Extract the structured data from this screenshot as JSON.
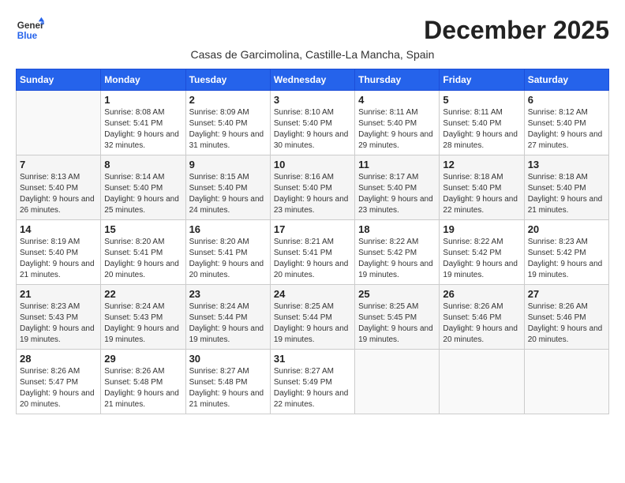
{
  "logo": {
    "general": "General",
    "blue": "Blue"
  },
  "title": "December 2025",
  "subtitle": "Casas de Garcimolina, Castille-La Mancha, Spain",
  "calendar": {
    "headers": [
      "Sunday",
      "Monday",
      "Tuesday",
      "Wednesday",
      "Thursday",
      "Friday",
      "Saturday"
    ],
    "weeks": [
      [
        {
          "day": "",
          "sunrise": "",
          "sunset": "",
          "daylight": "",
          "empty": true
        },
        {
          "day": "1",
          "sunrise": "Sunrise: 8:08 AM",
          "sunset": "Sunset: 5:41 PM",
          "daylight": "Daylight: 9 hours and 32 minutes."
        },
        {
          "day": "2",
          "sunrise": "Sunrise: 8:09 AM",
          "sunset": "Sunset: 5:40 PM",
          "daylight": "Daylight: 9 hours and 31 minutes."
        },
        {
          "day": "3",
          "sunrise": "Sunrise: 8:10 AM",
          "sunset": "Sunset: 5:40 PM",
          "daylight": "Daylight: 9 hours and 30 minutes."
        },
        {
          "day": "4",
          "sunrise": "Sunrise: 8:11 AM",
          "sunset": "Sunset: 5:40 PM",
          "daylight": "Daylight: 9 hours and 29 minutes."
        },
        {
          "day": "5",
          "sunrise": "Sunrise: 8:11 AM",
          "sunset": "Sunset: 5:40 PM",
          "daylight": "Daylight: 9 hours and 28 minutes."
        },
        {
          "day": "6",
          "sunrise": "Sunrise: 8:12 AM",
          "sunset": "Sunset: 5:40 PM",
          "daylight": "Daylight: 9 hours and 27 minutes."
        }
      ],
      [
        {
          "day": "7",
          "sunrise": "Sunrise: 8:13 AM",
          "sunset": "Sunset: 5:40 PM",
          "daylight": "Daylight: 9 hours and 26 minutes."
        },
        {
          "day": "8",
          "sunrise": "Sunrise: 8:14 AM",
          "sunset": "Sunset: 5:40 PM",
          "daylight": "Daylight: 9 hours and 25 minutes."
        },
        {
          "day": "9",
          "sunrise": "Sunrise: 8:15 AM",
          "sunset": "Sunset: 5:40 PM",
          "daylight": "Daylight: 9 hours and 24 minutes."
        },
        {
          "day": "10",
          "sunrise": "Sunrise: 8:16 AM",
          "sunset": "Sunset: 5:40 PM",
          "daylight": "Daylight: 9 hours and 23 minutes."
        },
        {
          "day": "11",
          "sunrise": "Sunrise: 8:17 AM",
          "sunset": "Sunset: 5:40 PM",
          "daylight": "Daylight: 9 hours and 23 minutes."
        },
        {
          "day": "12",
          "sunrise": "Sunrise: 8:18 AM",
          "sunset": "Sunset: 5:40 PM",
          "daylight": "Daylight: 9 hours and 22 minutes."
        },
        {
          "day": "13",
          "sunrise": "Sunrise: 8:18 AM",
          "sunset": "Sunset: 5:40 PM",
          "daylight": "Daylight: 9 hours and 21 minutes."
        }
      ],
      [
        {
          "day": "14",
          "sunrise": "Sunrise: 8:19 AM",
          "sunset": "Sunset: 5:40 PM",
          "daylight": "Daylight: 9 hours and 21 minutes."
        },
        {
          "day": "15",
          "sunrise": "Sunrise: 8:20 AM",
          "sunset": "Sunset: 5:41 PM",
          "daylight": "Daylight: 9 hours and 20 minutes."
        },
        {
          "day": "16",
          "sunrise": "Sunrise: 8:20 AM",
          "sunset": "Sunset: 5:41 PM",
          "daylight": "Daylight: 9 hours and 20 minutes."
        },
        {
          "day": "17",
          "sunrise": "Sunrise: 8:21 AM",
          "sunset": "Sunset: 5:41 PM",
          "daylight": "Daylight: 9 hours and 20 minutes."
        },
        {
          "day": "18",
          "sunrise": "Sunrise: 8:22 AM",
          "sunset": "Sunset: 5:42 PM",
          "daylight": "Daylight: 9 hours and 19 minutes."
        },
        {
          "day": "19",
          "sunrise": "Sunrise: 8:22 AM",
          "sunset": "Sunset: 5:42 PM",
          "daylight": "Daylight: 9 hours and 19 minutes."
        },
        {
          "day": "20",
          "sunrise": "Sunrise: 8:23 AM",
          "sunset": "Sunset: 5:42 PM",
          "daylight": "Daylight: 9 hours and 19 minutes."
        }
      ],
      [
        {
          "day": "21",
          "sunrise": "Sunrise: 8:23 AM",
          "sunset": "Sunset: 5:43 PM",
          "daylight": "Daylight: 9 hours and 19 minutes."
        },
        {
          "day": "22",
          "sunrise": "Sunrise: 8:24 AM",
          "sunset": "Sunset: 5:43 PM",
          "daylight": "Daylight: 9 hours and 19 minutes."
        },
        {
          "day": "23",
          "sunrise": "Sunrise: 8:24 AM",
          "sunset": "Sunset: 5:44 PM",
          "daylight": "Daylight: 9 hours and 19 minutes."
        },
        {
          "day": "24",
          "sunrise": "Sunrise: 8:25 AM",
          "sunset": "Sunset: 5:44 PM",
          "daylight": "Daylight: 9 hours and 19 minutes."
        },
        {
          "day": "25",
          "sunrise": "Sunrise: 8:25 AM",
          "sunset": "Sunset: 5:45 PM",
          "daylight": "Daylight: 9 hours and 19 minutes."
        },
        {
          "day": "26",
          "sunrise": "Sunrise: 8:26 AM",
          "sunset": "Sunset: 5:46 PM",
          "daylight": "Daylight: 9 hours and 20 minutes."
        },
        {
          "day": "27",
          "sunrise": "Sunrise: 8:26 AM",
          "sunset": "Sunset: 5:46 PM",
          "daylight": "Daylight: 9 hours and 20 minutes."
        }
      ],
      [
        {
          "day": "28",
          "sunrise": "Sunrise: 8:26 AM",
          "sunset": "Sunset: 5:47 PM",
          "daylight": "Daylight: 9 hours and 20 minutes."
        },
        {
          "day": "29",
          "sunrise": "Sunrise: 8:26 AM",
          "sunset": "Sunset: 5:48 PM",
          "daylight": "Daylight: 9 hours and 21 minutes."
        },
        {
          "day": "30",
          "sunrise": "Sunrise: 8:27 AM",
          "sunset": "Sunset: 5:48 PM",
          "daylight": "Daylight: 9 hours and 21 minutes."
        },
        {
          "day": "31",
          "sunrise": "Sunrise: 8:27 AM",
          "sunset": "Sunset: 5:49 PM",
          "daylight": "Daylight: 9 hours and 22 minutes."
        },
        {
          "day": "",
          "sunrise": "",
          "sunset": "",
          "daylight": "",
          "empty": true
        },
        {
          "day": "",
          "sunrise": "",
          "sunset": "",
          "daylight": "",
          "empty": true
        },
        {
          "day": "",
          "sunrise": "",
          "sunset": "",
          "daylight": "",
          "empty": true
        }
      ]
    ]
  }
}
